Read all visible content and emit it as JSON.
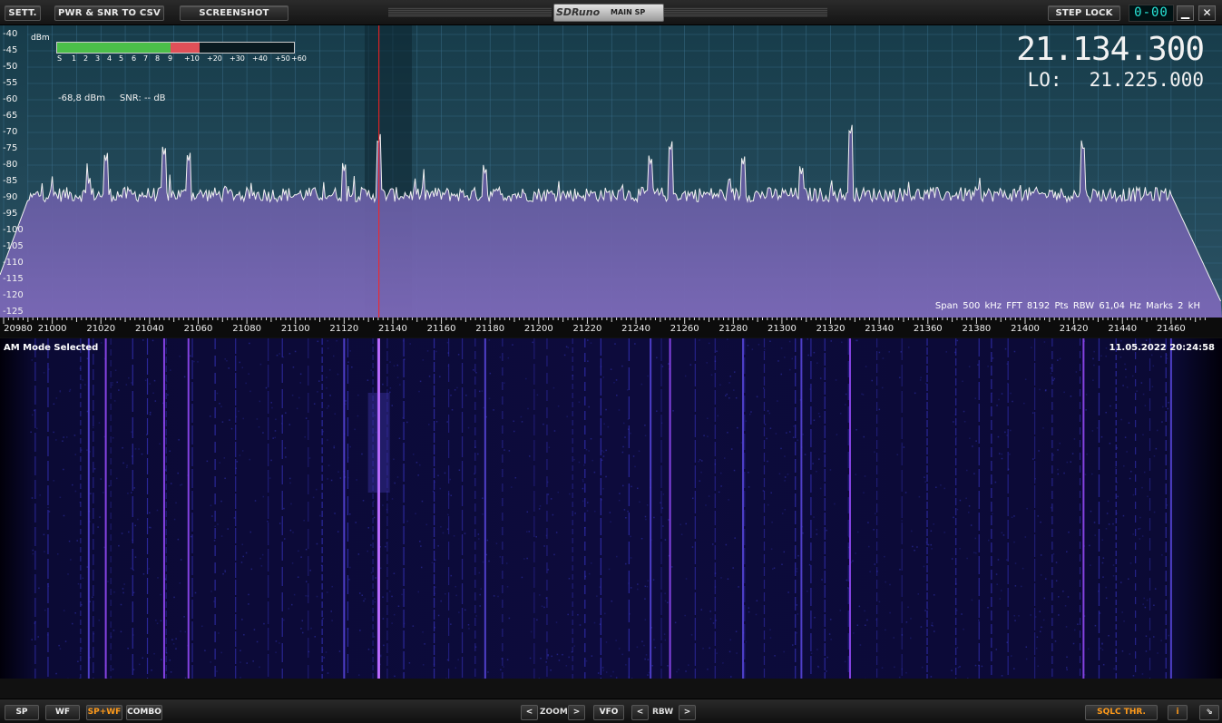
{
  "top_bar": {
    "sett_label": "SETT.",
    "csv_label": "PWR & SNR TO CSV",
    "screenshot_label": "SCREENSHOT",
    "logo_text": "SDRuno",
    "window_name": "MAIN SP",
    "step_lock_label": "STEP LOCK",
    "mini_display": "0-00",
    "minimize_glyph": "▁",
    "close_glyph": "✕"
  },
  "spectrum": {
    "unit": "dBm",
    "y_ticks": [
      "-40",
      "-45",
      "-50",
      "-55",
      "-60",
      "-65",
      "-70",
      "-75",
      "-80",
      "-85",
      "-90",
      "-95",
      "-100",
      "-105",
      "-110",
      "-115",
      "-120",
      "-125"
    ],
    "smeter_scale": [
      "S",
      "1",
      "2",
      "3",
      "4",
      "5",
      "6",
      "7",
      "8",
      "9",
      "+10",
      "+20",
      "+30",
      "+40",
      "+50",
      "+60"
    ],
    "smeter_level_fraction": 0.6,
    "smeter_red_start_fraction": 0.48,
    "power_reading": "-68,8 dBm",
    "snr_reading": "SNR: -- dB",
    "frequency": "21.134.300",
    "lo_label": "LO:",
    "lo_value": "21.225.000",
    "info": "Span 500 kHz  FFT 8192 Pts  RBW 61,04 Hz  Marks 2 kH",
    "x_ticks": [
      "20980",
      "21000",
      "21020",
      "21040",
      "21060",
      "21080",
      "21100",
      "21120",
      "21140",
      "21160",
      "21180",
      "21200",
      "21220",
      "21240",
      "21260",
      "21280",
      "21300",
      "21320",
      "21340",
      "21360",
      "21380",
      "21400",
      "21420",
      "21440",
      "21460"
    ]
  },
  "chart_data": {
    "type": "line",
    "xlabel": "",
    "ylabel": "dBm",
    "xlim": [
      20980,
      21475
    ],
    "ylim": [
      -127,
      -40
    ],
    "tuned_khz": 21134.3,
    "noise_floor_dbm": -89,
    "band_edges_khz": [
      20990,
      21460
    ],
    "peaks": [
      {
        "x": 21015,
        "y": -86
      },
      {
        "x": 21022,
        "y": -79
      },
      {
        "x": 21046,
        "y": -77
      },
      {
        "x": 21056,
        "y": -79
      },
      {
        "x": 21120,
        "y": -82
      },
      {
        "x": 21134,
        "y": -74
      },
      {
        "x": 21178,
        "y": -83
      },
      {
        "x": 21246,
        "y": -80
      },
      {
        "x": 21254,
        "y": -76
      },
      {
        "x": 21284,
        "y": -80
      },
      {
        "x": 21308,
        "y": -83
      },
      {
        "x": 21328,
        "y": -71
      },
      {
        "x": 21424,
        "y": -76
      },
      {
        "x": 21460,
        "y": -97
      }
    ]
  },
  "status": {
    "mode": "AM Mode Selected",
    "datetime": "11.05.2022 20:24:58"
  },
  "bottom_bar": {
    "sp_label": "SP",
    "wf_label": "WF",
    "spwf_label": "SP+WF",
    "combo_label": "COMBO",
    "zoom_label": "ZOOM",
    "vfo_label": "VFO",
    "rbw_label": "RBW",
    "left_arrow": "<",
    "right_arrow": ">",
    "sqlc_label": "SQLC THR.",
    "info_label": "i",
    "resize_glyph": "⇘"
  },
  "colors": {
    "spectrum_bg": "#1e4a5a",
    "spectrum_fill": "#6c5fa8",
    "trace": "#f0f0f0",
    "tuning_line": "#ff2020",
    "freq_text": "#f2f2f2",
    "accent_orange": "#ff9a1a"
  }
}
